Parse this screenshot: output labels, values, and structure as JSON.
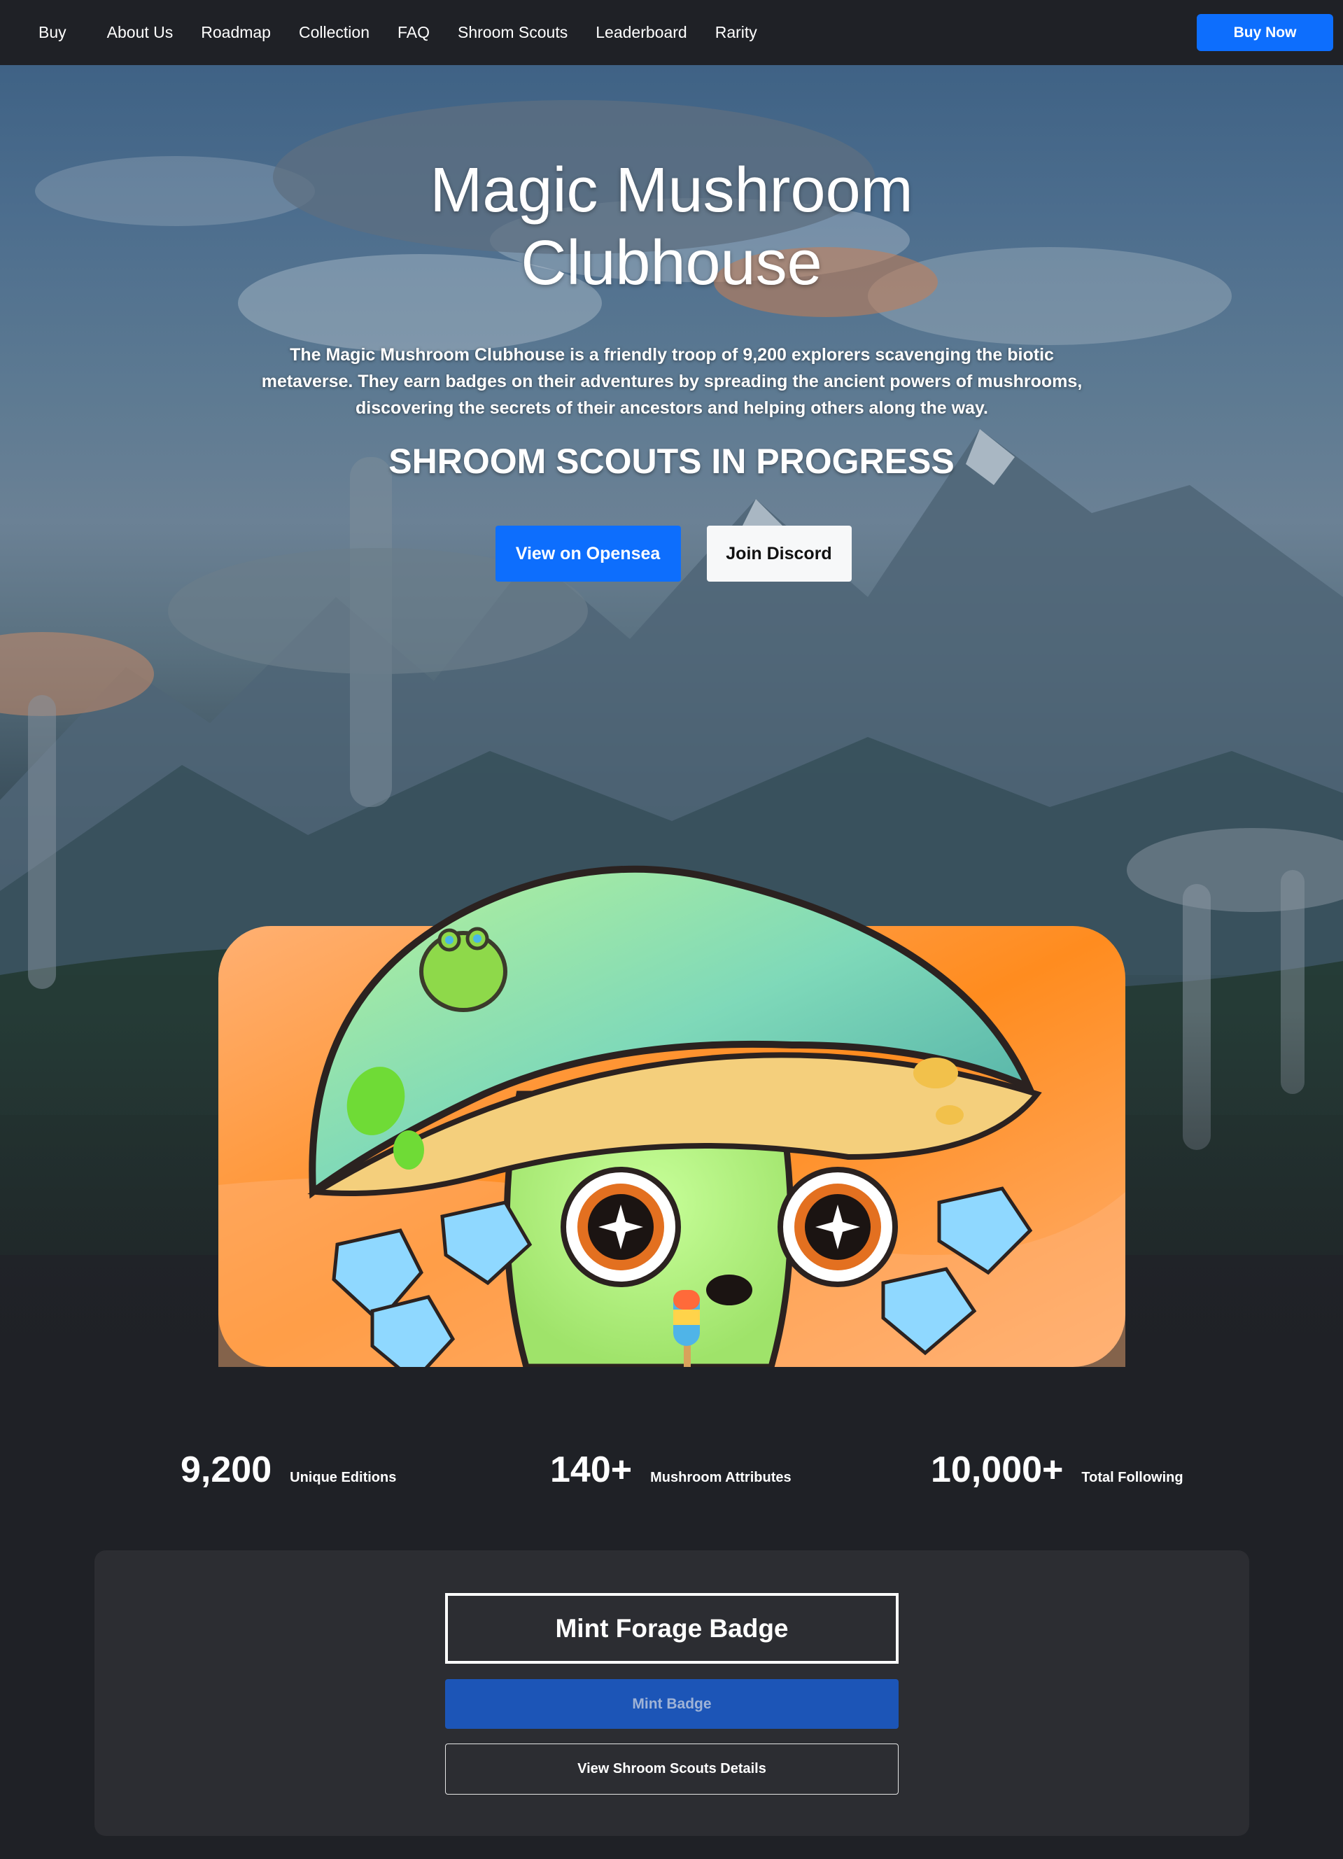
{
  "nav": {
    "links": [
      "Buy",
      "About Us",
      "Roadmap",
      "Collection",
      "FAQ",
      "Shroom Scouts",
      "Leaderboard",
      "Rarity"
    ],
    "buy_now": "Buy Now"
  },
  "hero": {
    "title_line1": "Magic Mushroom",
    "title_line2": "Clubhouse",
    "description_line1": "The Magic Mushroom Clubhouse is a friendly troop of 9,200 explorers scavenging the biotic",
    "description_line2": "metaverse. They earn badges on their adventures by spreading the ancient powers of mushrooms,",
    "description_line3": "discovering the secrets of their ancestors and helping others along the way.",
    "subtitle": "SHROOM SCOUTS IN PROGRESS",
    "opensea_button": "View on Opensea",
    "discord_button": "Join Discord"
  },
  "stats": [
    {
      "value": "9,200",
      "label": "Unique Editions"
    },
    {
      "value": "140+",
      "label": "Mushroom Attributes"
    },
    {
      "value": "10,000+",
      "label": "Total Following"
    }
  ],
  "mint": {
    "title": "Mint Forage Badge",
    "mint_button": "Mint Badge",
    "details_button": "View Shroom Scouts Details"
  },
  "colors": {
    "page_bg": "#1f2126",
    "primary": "#0d6efd",
    "panel_bg": "#2c2d32",
    "card_orange": "#ff8c1f"
  }
}
